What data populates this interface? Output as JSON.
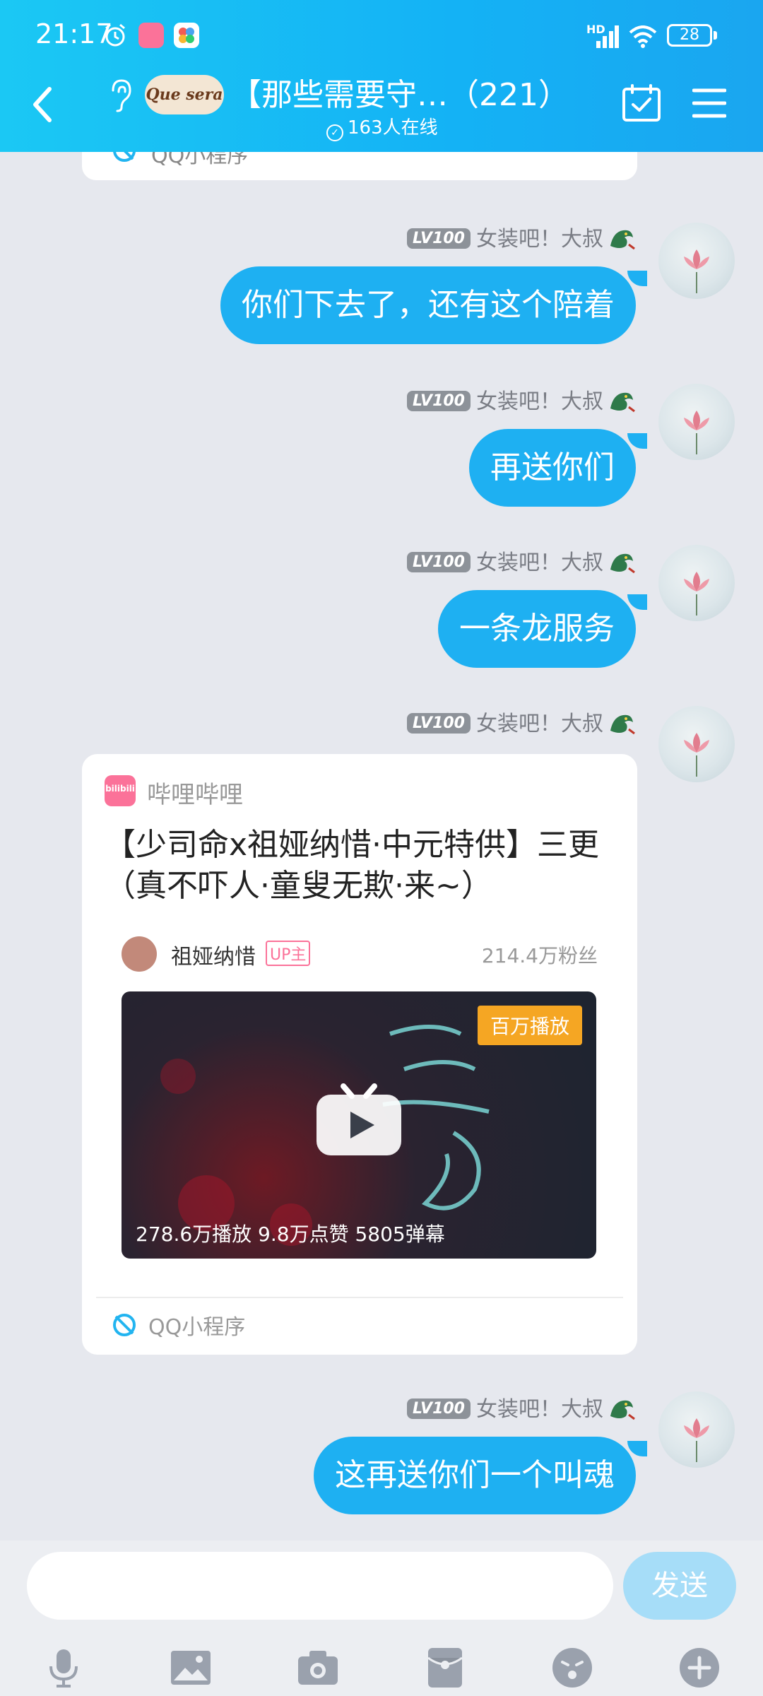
{
  "status_bar": {
    "time": "21:17",
    "network_label": "HD",
    "battery": "28"
  },
  "header": {
    "group_avatar_text": "Que sera",
    "title": "【那些需要守…（221）",
    "online": "163人在线"
  },
  "previous_card": {
    "mini_program_label": "QQ小程序"
  },
  "messages": [
    {
      "level": "LV100",
      "sender": "女装吧！大叔",
      "text": "你们下去了，还有这个陪着"
    },
    {
      "level": "LV100",
      "sender": "女装吧！大叔",
      "text": "再送你们"
    },
    {
      "level": "LV100",
      "sender": "女装吧！大叔",
      "text": "一条龙服务"
    },
    {
      "level": "LV100",
      "sender": "女装吧！大叔"
    },
    {
      "level": "LV100",
      "sender": "女装吧！大叔",
      "text": "这再送你们一个叫魂"
    }
  ],
  "share_card": {
    "app_icon_text": "bilibili",
    "source": "哔哩哔哩",
    "title": "【少司命x祖娅纳惜·中元特供】三更（真不吓人·童叟无欺·来~）",
    "uploader": "祖娅纳惜",
    "up_badge": "UP主",
    "fans": "214.4万粉丝",
    "hot_badge": "百万播放",
    "stats": "278.6万播放  9.8万点赞  5805弹幕",
    "mini_program_label": "QQ小程序"
  },
  "input": {
    "placeholder": "",
    "send_label": "发送"
  },
  "colors": {
    "header_start": "#1bc8f4",
    "header_end": "#1aa6f0",
    "bubble": "#1eb0f2",
    "bilibili_pink": "#fb7299",
    "hot_badge": "#f5a623"
  },
  "toolbar_icons": [
    "microphone-icon",
    "image-icon",
    "camera-icon",
    "red-packet-icon",
    "emoji-icon",
    "plus-icon"
  ]
}
